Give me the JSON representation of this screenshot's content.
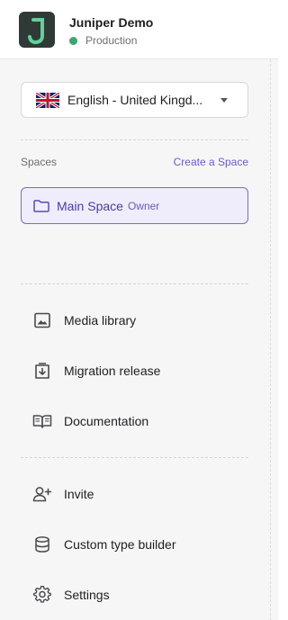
{
  "header": {
    "app_name": "Juniper Demo",
    "environment": "Production",
    "environment_color": "#3ba66b",
    "logo_letter": "J",
    "logo_colors": {
      "background": "#2f3a36",
      "letter": "#5fd19a"
    }
  },
  "language": {
    "selected": "English - United Kingd...",
    "flag_icon": "uk-flag-icon"
  },
  "spaces": {
    "section_label": "Spaces",
    "create_label": "Create a Space",
    "items": [
      {
        "name": "Main Space",
        "role": "Owner",
        "icon": "folder-icon"
      }
    ]
  },
  "nav_primary": [
    {
      "label": "Media library",
      "icon": "image-icon"
    },
    {
      "label": "Migration release",
      "icon": "release-download-icon"
    },
    {
      "label": "Documentation",
      "icon": "book-icon"
    }
  ],
  "nav_secondary": [
    {
      "label": "Invite",
      "icon": "add-user-icon"
    },
    {
      "label": "Custom type builder",
      "icon": "database-icon"
    },
    {
      "label": "Settings",
      "icon": "gear-icon"
    }
  ],
  "colors": {
    "accent": "#6c5ad1",
    "selected_background": "#efedfb"
  }
}
